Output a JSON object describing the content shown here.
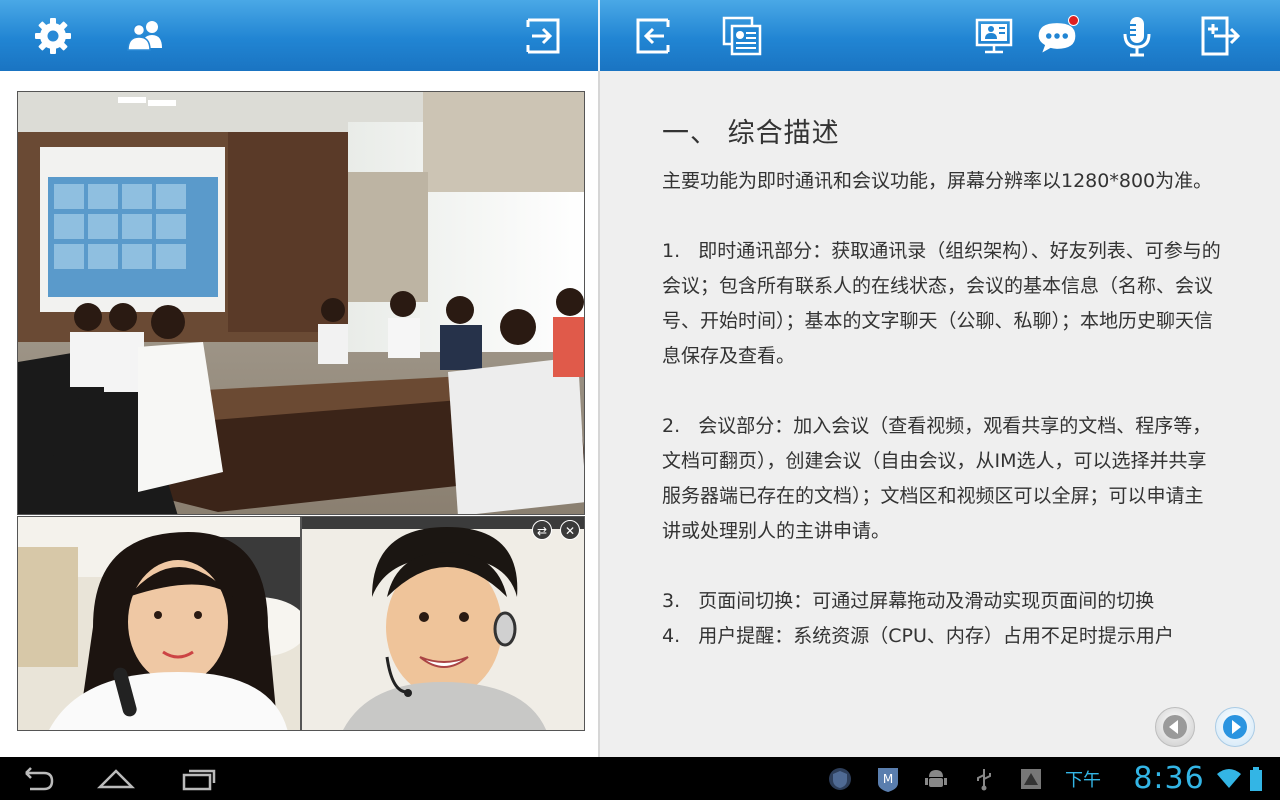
{
  "toolbar_left": {
    "icons": [
      "gear-icon",
      "contacts-icon",
      "exit-icon"
    ]
  },
  "toolbar_right": {
    "icons": [
      "back-icon",
      "documents-icon",
      "screen-share-icon",
      "chat-icon",
      "microphone-icon",
      "switch-pane-icon"
    ],
    "chat_has_notification": true
  },
  "videos": {
    "main": "conference-room-video",
    "sub": [
      "participant-woman-video",
      "participant-man-video"
    ],
    "controls": [
      "swap-icon",
      "close-icon"
    ]
  },
  "document": {
    "title": "一、  综合描述",
    "intro": "主要功能为即时通讯和会议功能，屏幕分辨率以1280*800为准。",
    "item1": "1.   即时通讯部分：获取通讯录（组织架构）、好友列表、可参与的会议；包含所有联系人的在线状态，会议的基本信息（名称、会议号、开始时间）；基本的文字聊天（公聊、私聊）；本地历史聊天信息保存及查看。",
    "item2": "2.   会议部分：加入会议（查看视频，观看共享的文档、程序等，文档可翻页），创建会议（自由会议，从IM选人，可以选择并共享服务器端已存在的文档）；文档区和视频区可以全屏；可以申请主讲或处理别人的主讲申请。",
    "item3": "3.   页面间切换：可通过屏幕拖动及滑动实现页面间的切换",
    "item4": "4.   用户提醒：系统资源（CPU、内存）占用不足时提示用户"
  },
  "pager": {
    "prev": "prev-page-icon",
    "next": "next-page-icon"
  },
  "system_bar": {
    "ampm": "下午",
    "time": "8:36",
    "accent": "#33b5e5"
  },
  "colors": {
    "toolbar": "#2185d3",
    "doc_bg": "#efefef"
  }
}
